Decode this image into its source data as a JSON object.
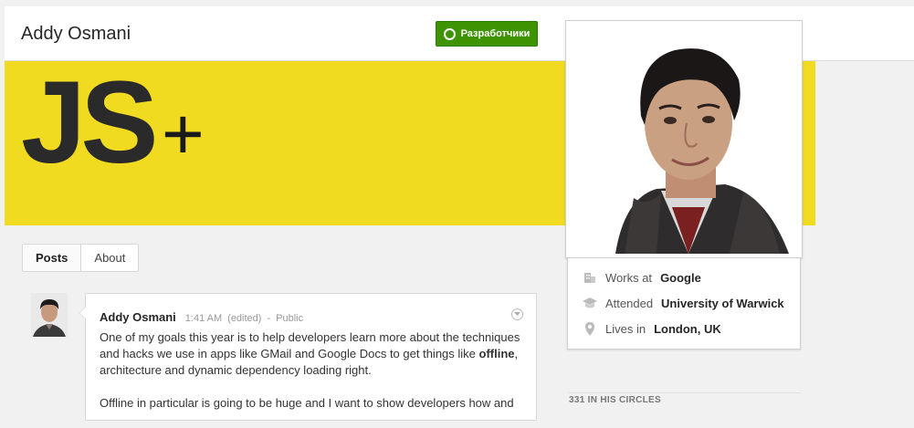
{
  "header": {
    "profile_name": "Addy Osmani",
    "developers_button": "Разработчики"
  },
  "cover": {
    "logo_text": "JS",
    "plus_text": "+",
    "background_color": "#f0db21"
  },
  "tabs": [
    {
      "label": "Posts",
      "active": true
    },
    {
      "label": "About",
      "active": false
    }
  ],
  "post": {
    "author": "Addy Osmani",
    "time": "1:41 AM",
    "edited": "(edited)",
    "separator": "-",
    "visibility": "Public",
    "body_1_before": "One of my goals this year is to help developers learn more about the techniques and hacks we use in apps like GMail and Google Docs to get things like ",
    "body_1_bold": "offline",
    "body_1_after": ", architecture and dynamic dependency loading right.",
    "body_2": "Offline in particular is going to be huge and I want to show developers how and"
  },
  "about": {
    "work_prefix": "Works at",
    "work_value": "Google",
    "edu_prefix": "Attended",
    "edu_value": "University of Warwick",
    "loc_prefix": "Lives in",
    "loc_value": "London, UK"
  },
  "circles": {
    "label": "331 IN HIS CIRCLES"
  },
  "colors": {
    "accent_green": "#3d9400",
    "cover_yellow": "#f0db21"
  }
}
